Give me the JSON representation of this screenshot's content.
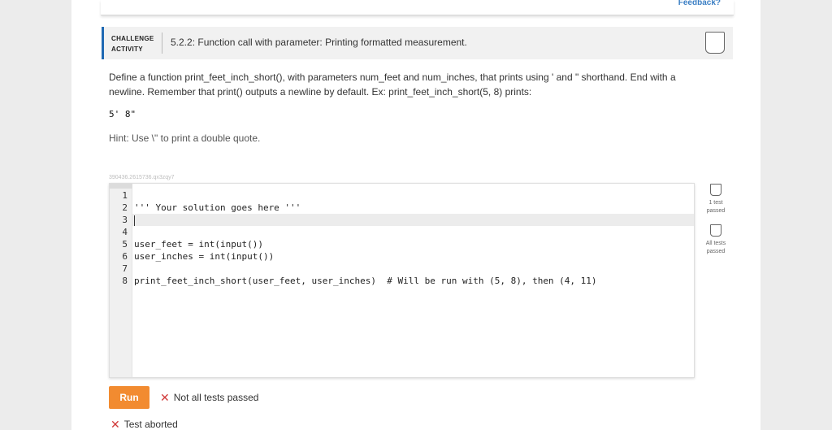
{
  "header": {
    "feedback_link": "Feedback?"
  },
  "challenge": {
    "label": "CHALLENGE ACTIVITY",
    "title": "5.2.2: Function call with parameter: Printing formatted measurement."
  },
  "content": {
    "description": "Define a function print_feet_inch_short(), with parameters num_feet and num_inches, that prints using ' and \" shorthand. End with a newline. Remember that print() outputs a newline by default. Ex: print_feet_inch_short(5, 8) prints:",
    "example_output": "5' 8\"",
    "hint": "Hint: Use \\\" to print a double quote."
  },
  "id_line": "390436.2615736.qx3zqy7",
  "editor": {
    "lines": [
      {
        "num": "1",
        "code": ""
      },
      {
        "num": "2",
        "code": "''' Your solution goes here '''"
      },
      {
        "num": "3",
        "code": ""
      },
      {
        "num": "4",
        "code": ""
      },
      {
        "num": "5",
        "code": "user_feet = int(input())"
      },
      {
        "num": "6",
        "code": "user_inches = int(input())"
      },
      {
        "num": "7",
        "code": ""
      },
      {
        "num": "8",
        "code": "print_feet_inch_short(user_feet, user_inches)  # Will be run with (5, 8), then (4, 11)"
      }
    ]
  },
  "tests": {
    "test1_label": "1 test passed",
    "all_label": "All tests passed"
  },
  "run": {
    "button_label": "Run",
    "status_label": "Not all tests passed",
    "abort_label": "Test aborted"
  },
  "icons": {
    "status_fail": "x-icon",
    "test_box": "shield-icon"
  },
  "colors": {
    "accent": "#1f69b3",
    "run_button": "#f28b30",
    "fail": "#d13b3b",
    "link": "#3b7fc4"
  }
}
